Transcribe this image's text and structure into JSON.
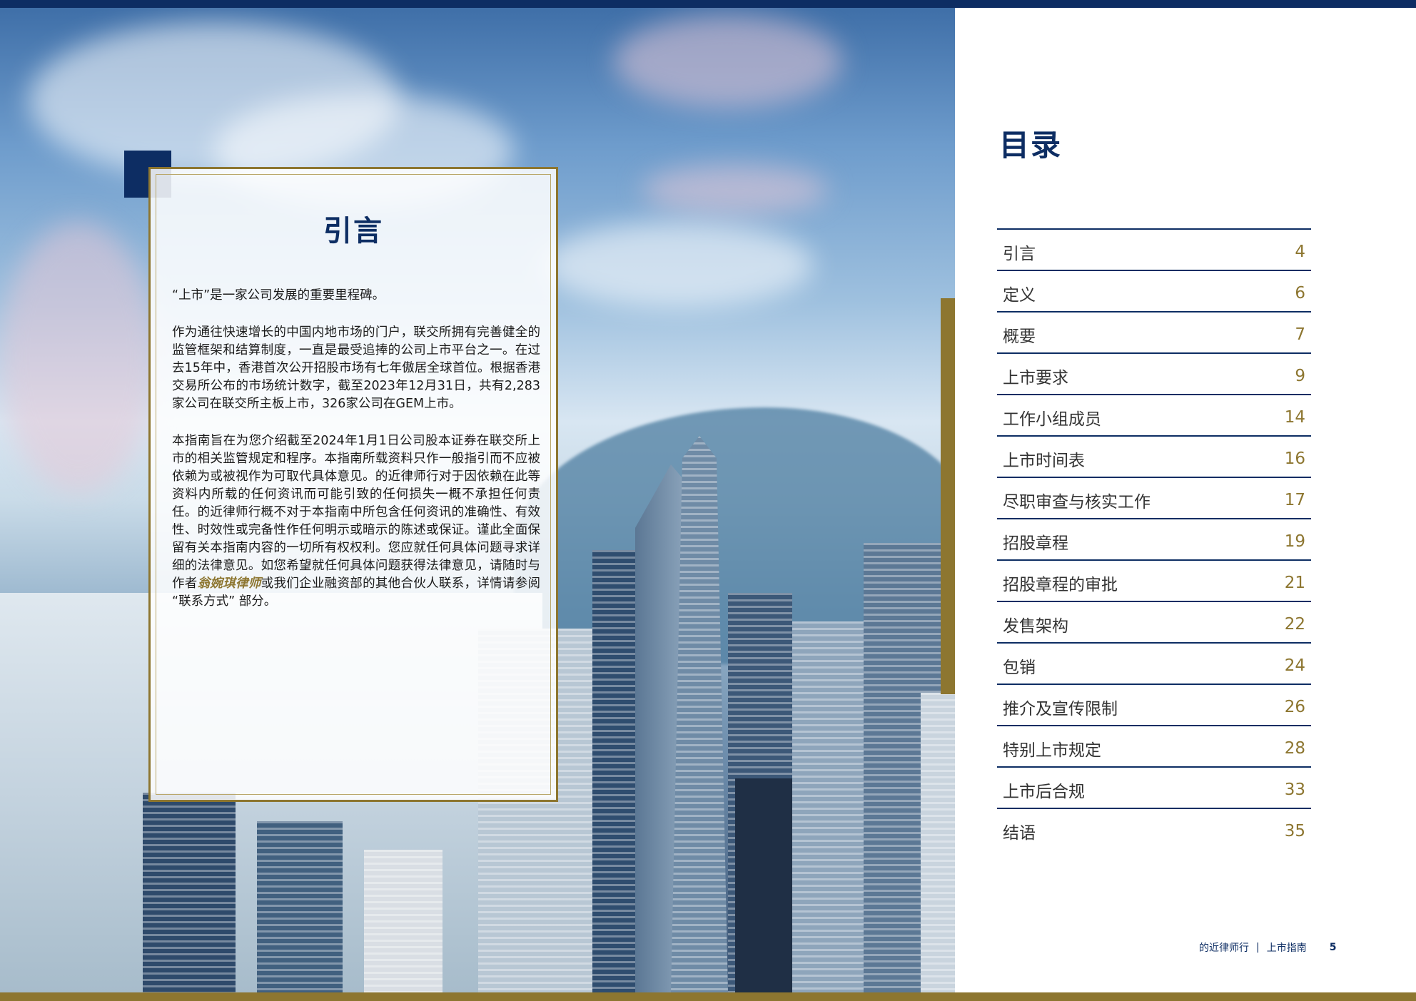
{
  "intro": {
    "title": "引言",
    "p1": "“上市”是一家公司发展的重要里程碑。",
    "p2": "作为通往快速增长的中国内地市场的门户，联交所拥有完善健全的监管框架和结算制度，一直是最受追捧的公司上市平台之一。在过去15年中，香港首次公开招股市场有七年傲居全球首位。根据香港交易所公布的市场统计数字，截至2023年12月31日，共有2,283家公司在联交所主板上市，326家公司在GEM上市。",
    "p3_before": "本指南旨在为您介绍截至2024年1月1日公司股本证券在联交所上市的相关监管规定和程序。本指南所载资料只作一般指引而不应被依赖为或被视作为可取代具体意见。的近律师行对于因依赖在此等资料内所载的任何资讯而可能引致的任何损失一概不承担任何责任。的近律师行概不对于本指南中所包含任何资讯的准确性、有效性、时效性或完备性作任何明示或暗示的陈述或保证。谨此全面保留有关本指南内容的一切所有权权利。您应就任何具体问题寻求详细的法律意见。如您希望就任何具体问题获得法律意见，请随时与作者",
    "p3_link": "翁婉琪律师",
    "p3_after": "或我们企业融资部的其他合伙人联系，详情请参阅 “联系方式” 部分。"
  },
  "toc": {
    "title": "目录",
    "items": [
      {
        "label": "引言",
        "page": "4"
      },
      {
        "label": "定义",
        "page": "6"
      },
      {
        "label": "概要",
        "page": "7"
      },
      {
        "label": "上市要求",
        "page": "9"
      },
      {
        "label": "工作小组成员",
        "page": "14"
      },
      {
        "label": "上市时间表",
        "page": "16"
      },
      {
        "label": "尽职审查与核实工作",
        "page": "17"
      },
      {
        "label": "招股章程",
        "page": "19"
      },
      {
        "label": "招股章程的审批",
        "page": "21"
      },
      {
        "label": "发售架构",
        "page": "22"
      },
      {
        "label": "包销",
        "page": "24"
      },
      {
        "label": "推介及宣传限制",
        "page": "26"
      },
      {
        "label": "特别上市规定",
        "page": "28"
      },
      {
        "label": "上市后合规",
        "page": "33"
      },
      {
        "label": "结语",
        "page": "35"
      }
    ]
  },
  "footer": {
    "firm": "的近律师行",
    "separator": "|",
    "guide": "上市指南",
    "page_number": "5"
  },
  "colors": {
    "navy": "#0d2d63",
    "gold": "#8d7630"
  }
}
